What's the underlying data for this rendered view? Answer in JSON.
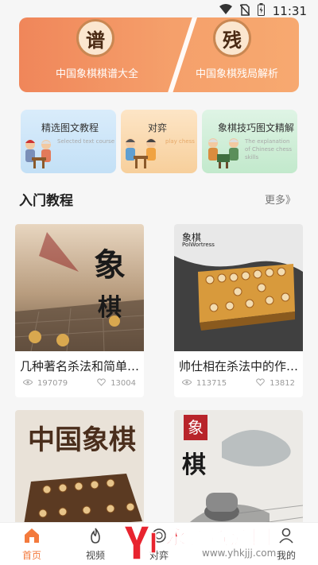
{
  "status_bar": {
    "time": "11:31"
  },
  "banner": {
    "left_char": "谱",
    "left_caption": "中国象棋棋谱大全",
    "right_char": "残",
    "right_caption": "中国象棋残局解析"
  },
  "feature_cards": [
    {
      "title": "精选图文教程",
      "subtitle": "Selected text course"
    },
    {
      "title": "对弈",
      "subtitle": "play chess"
    },
    {
      "title": "象棋技巧图文精解",
      "subtitle": "The explanation of Chinese chess skills"
    }
  ],
  "section": {
    "title": "入门教程",
    "more": "更多》"
  },
  "articles": [
    {
      "title": "几种著名杀法和简单…",
      "views": "197079",
      "likes": "13004",
      "art": "象棋"
    },
    {
      "title": "帅仕相在杀法中的作…",
      "views": "113715",
      "likes": "13812",
      "art_small": "象棋",
      "art_latin": "PolWortress"
    },
    {
      "art": "中国象棋"
    },
    {
      "art_top": "象",
      "art_bottom": "棋"
    }
  ],
  "tabs": [
    {
      "label": "首页",
      "active": true,
      "icon": "home-icon"
    },
    {
      "label": "视频",
      "active": false,
      "icon": "flame-icon"
    },
    {
      "label": "对弈",
      "active": false,
      "icon": "chess-icon"
    },
    {
      "label": "",
      "active": false,
      "icon": "tab-icon"
    },
    {
      "label": "我的",
      "active": false,
      "icon": "user-icon"
    }
  ],
  "watermark": {
    "text": "永辉资源网",
    "url": "www.yhkjjj.com"
  },
  "colors": {
    "accent": "#f37a3d",
    "banner": "#f5a06b",
    "watermark": "#e8242f"
  }
}
